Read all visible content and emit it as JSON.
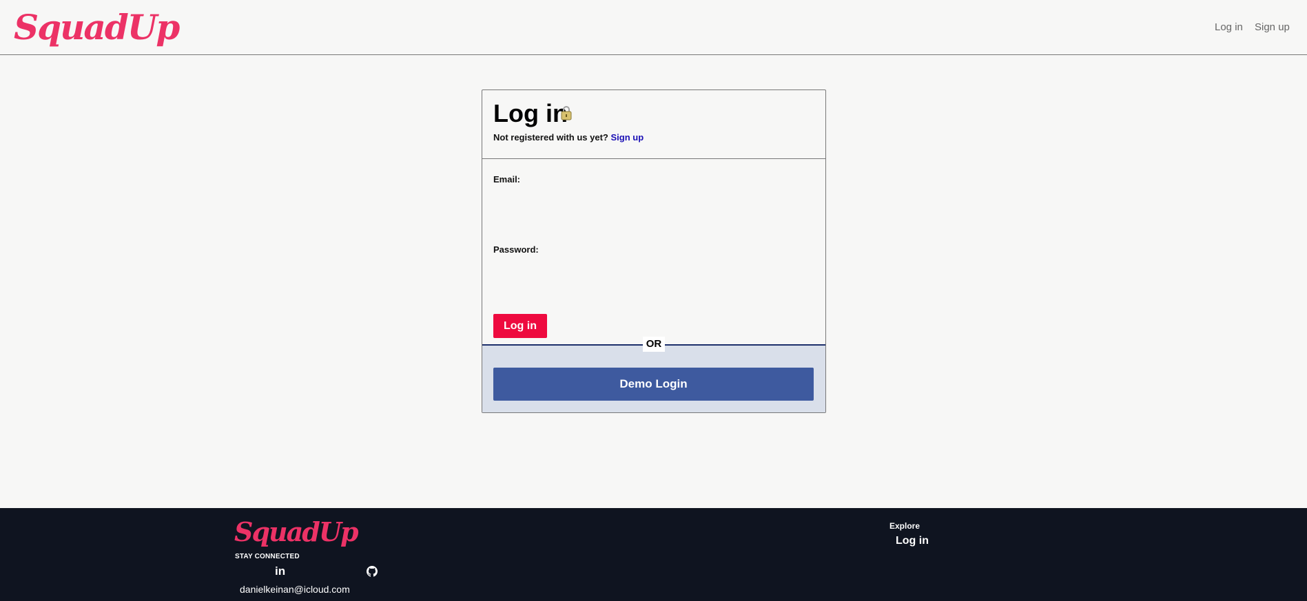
{
  "header": {
    "brand": "SquadUp",
    "nav": {
      "login": "Log in",
      "signup": "Sign up"
    }
  },
  "login_card": {
    "title": "Log in",
    "subtitle_text": "Not registered with us yet?",
    "subtitle_link": "Sign up",
    "email_label": "Email:",
    "email_value": "",
    "password_label": "Password:",
    "password_value": "",
    "login_button": "Log in",
    "or_divider": "OR",
    "demo_button": "Demo Login"
  },
  "footer": {
    "brand": "SquadUp",
    "stay_connected": "STAY CONNECTED",
    "linkedin_glyph": "in",
    "email": "danielkeinan@icloud.com",
    "explore_title": "Explore",
    "explore_login": "Log in"
  },
  "colors": {
    "brand": "#ec3266",
    "login_button": "#ee0a3f",
    "demo_button": "#3e5a9f",
    "link": "#1a0fb5",
    "footer_bg": "#0f1420"
  }
}
